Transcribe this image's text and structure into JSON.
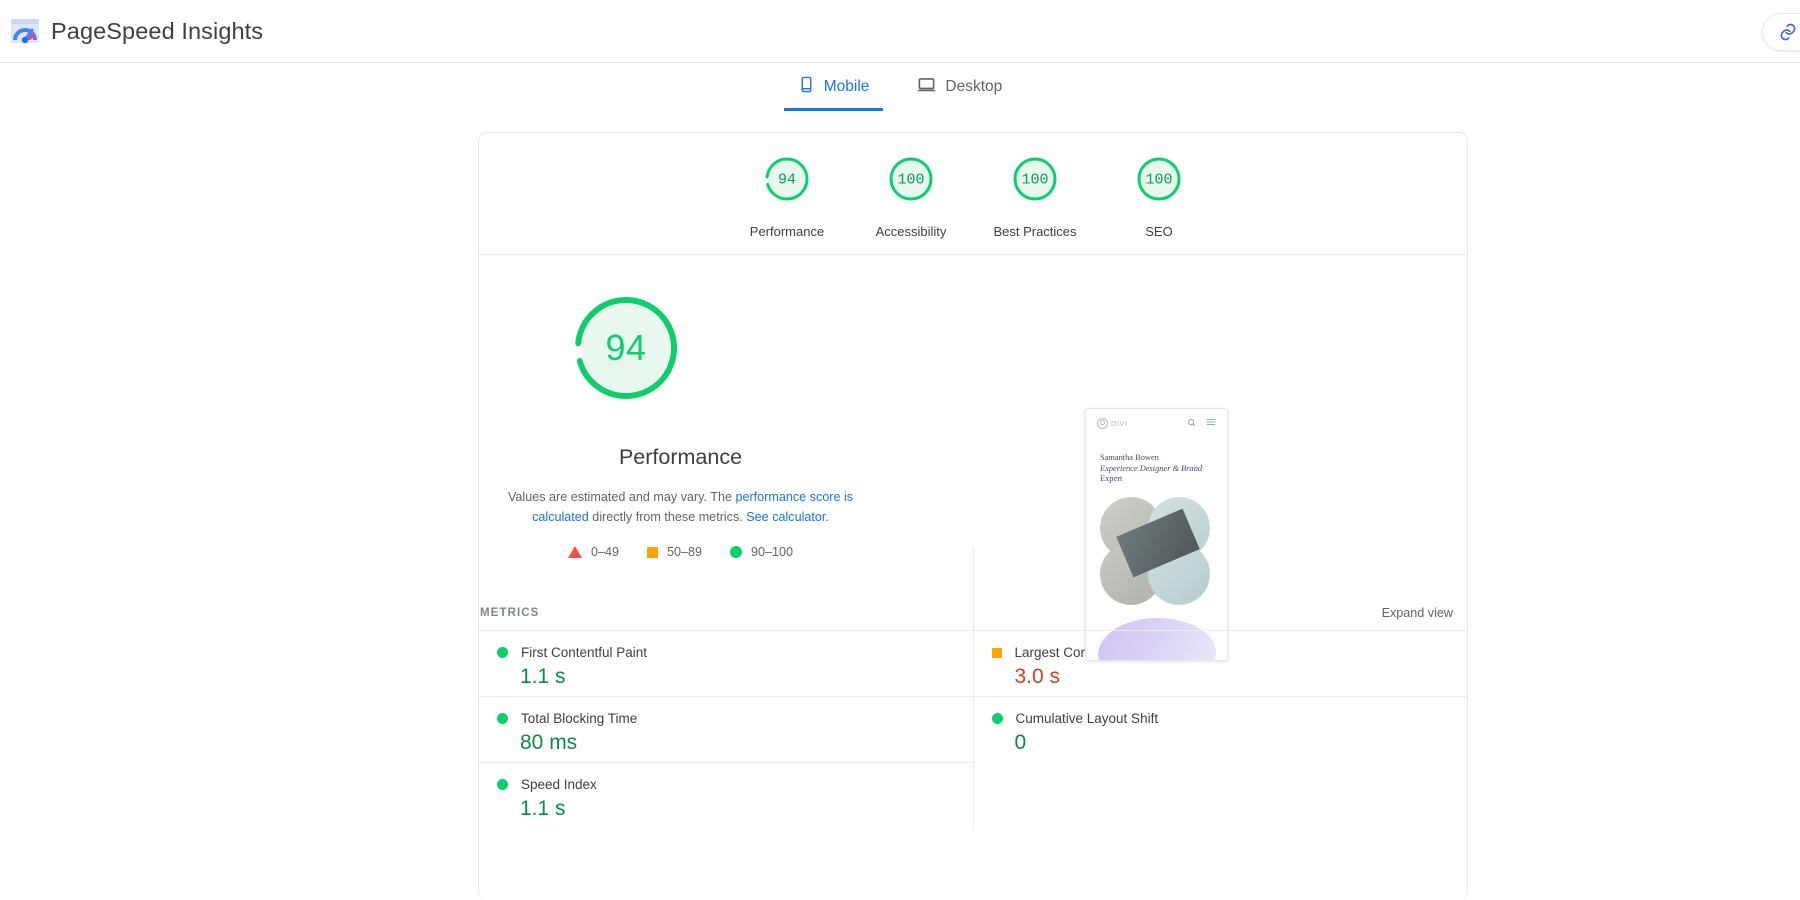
{
  "app": {
    "title": "PageSpeed Insights",
    "logo_icon": "pagespeed-logo-icon",
    "actions": [
      {
        "name": "share-link-button",
        "icon": "link-icon"
      },
      {
        "name": "secondary-button",
        "icon": "circle-icon"
      }
    ]
  },
  "tabs": [
    {
      "label": "Mobile",
      "icon": "mobile-phone-icon",
      "active": true
    },
    {
      "label": "Desktop",
      "icon": "laptop-icon",
      "active": false
    }
  ],
  "category_scores": [
    {
      "label": "Performance",
      "score": "94",
      "value": 94,
      "color": "#0cce6b"
    },
    {
      "label": "Accessibility",
      "score": "100",
      "value": 100,
      "color": "#0cce6b"
    },
    {
      "label": "Best Practices",
      "score": "100",
      "value": 100,
      "color": "#0cce6b"
    },
    {
      "label": "SEO",
      "score": "100",
      "value": 100,
      "color": "#0cce6b"
    }
  ],
  "hero": {
    "score": "94",
    "value": 94,
    "title": "Performance",
    "desc_pre": "Values are estimated and may vary. The ",
    "desc_link1": "performance score is calculated",
    "desc_mid": " directly from these metrics. ",
    "desc_link2": "See calculator",
    "desc_post": ".",
    "legend": [
      {
        "label": "0–49",
        "shape": "triangle",
        "color": "#ff4e42"
      },
      {
        "label": "50–89",
        "shape": "square",
        "color": "#ffa400"
      },
      {
        "label": "90–100",
        "shape": "circle",
        "color": "#0cce6b"
      }
    ]
  },
  "thumbnail": {
    "logo_mark": "D",
    "logo_text": "DIVI",
    "search_icon": "search-icon",
    "menu_icon": "hamburger-menu-icon",
    "headline_line1": "Samantha Bowen",
    "headline_line2": "Experience Designer & Brand",
    "headline_line3": "Expert"
  },
  "metrics": {
    "section_title": "METRICS",
    "expand_label": "Expand view",
    "left": [
      {
        "name": "First Contentful Paint",
        "value": "1.1 s",
        "shape": "circle",
        "marker_color": "#0cce6b",
        "value_color": "#0a8a47"
      },
      {
        "name": "Total Blocking Time",
        "value": "80 ms",
        "shape": "circle",
        "marker_color": "#0cce6b",
        "value_color": "#0a8a47"
      },
      {
        "name": "Speed Index",
        "value": "1.1 s",
        "shape": "circle",
        "marker_color": "#0cce6b",
        "value_color": "#0a8a47"
      }
    ],
    "right": [
      {
        "name": "Largest Contentful Paint",
        "value": "3.0 s",
        "shape": "square",
        "marker_color": "#ffa400",
        "value_color": "#d93c17"
      },
      {
        "name": "Cumulative Layout Shift",
        "value": "0",
        "shape": "circle",
        "marker_color": "#0cce6b",
        "value_color": "#0a8a47"
      }
    ]
  }
}
